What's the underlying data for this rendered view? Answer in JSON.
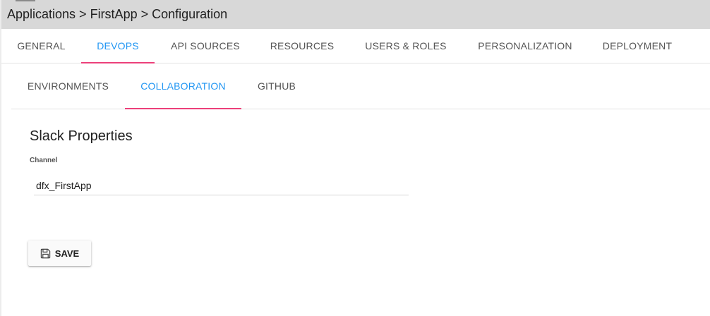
{
  "breadcrumb": {
    "text": "Applications > FirstApp > Configuration"
  },
  "top_tabs": [
    {
      "label": "GENERAL",
      "active": false
    },
    {
      "label": "DEVOPS",
      "active": true
    },
    {
      "label": "API SOURCES",
      "active": false
    },
    {
      "label": "RESOURCES",
      "active": false
    },
    {
      "label": "USERS & ROLES",
      "active": false
    },
    {
      "label": "PERSONALIZATION",
      "active": false
    },
    {
      "label": "DEPLOYMENT",
      "active": false
    }
  ],
  "sub_tabs": [
    {
      "label": "ENVIRONMENTS",
      "active": false
    },
    {
      "label": "COLLABORATION",
      "active": true
    },
    {
      "label": "GITHUB",
      "active": false
    }
  ],
  "section": {
    "title": "Slack Properties",
    "channel_label": "Channel",
    "channel_value": "dfx_FirstApp"
  },
  "save_button": {
    "label": "SAVE",
    "icon": "floppy-disk-icon"
  },
  "colors": {
    "accent": "#2196f3",
    "indicator": "#ec407a",
    "header_bg": "#d8d8d8"
  }
}
